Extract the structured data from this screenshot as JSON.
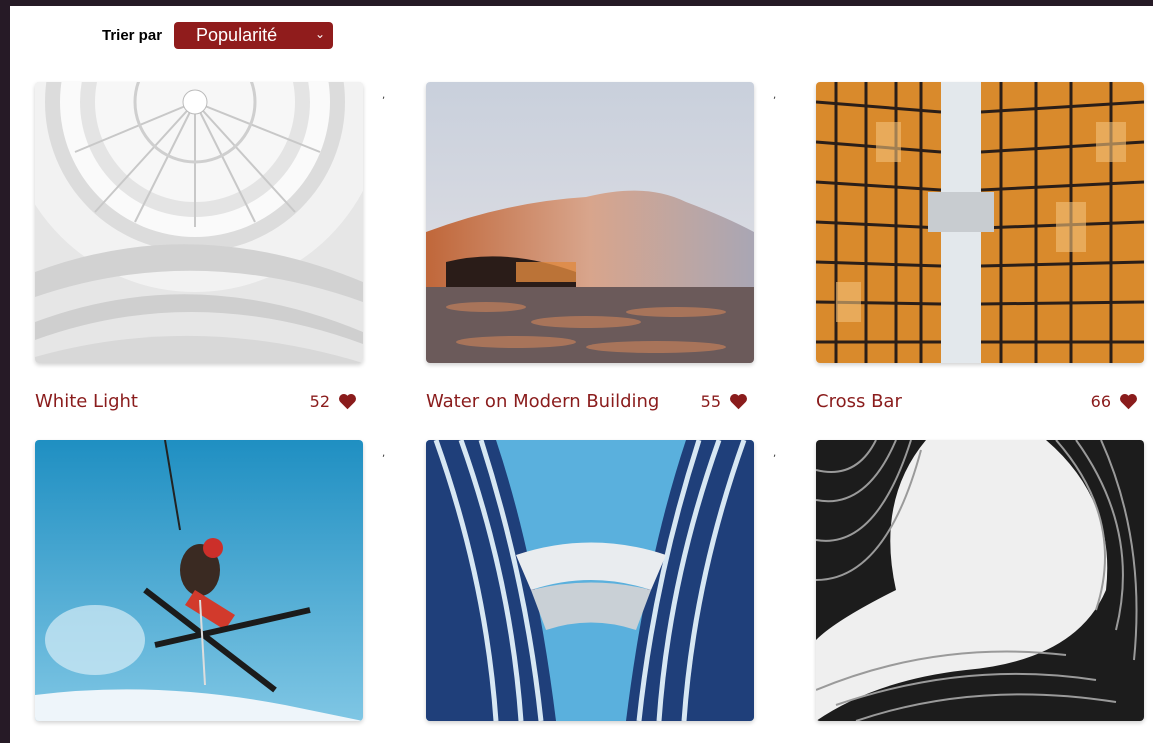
{
  "sort": {
    "label": "Trier par",
    "selected": "Popularité"
  },
  "gallery": {
    "items": [
      {
        "title": "White Light",
        "likes": "52",
        "image": "spiral-museum-dome"
      },
      {
        "title": "Water on Modern Building",
        "likes": "55",
        "image": "wave-building-over-water"
      },
      {
        "title": "Cross Bar",
        "likes": "66",
        "image": "skyscraper-glass-looking-up"
      },
      {
        "title": "",
        "likes": "",
        "image": "skier-jumping"
      },
      {
        "title": "",
        "likes": "",
        "image": "curved-blue-towers"
      },
      {
        "title": "",
        "likes": "",
        "image": "black-white-spiral-facade"
      }
    ]
  },
  "colors": {
    "accent": "#901c1c",
    "text_accent": "#8a1c1c",
    "frame": "#261a26"
  }
}
